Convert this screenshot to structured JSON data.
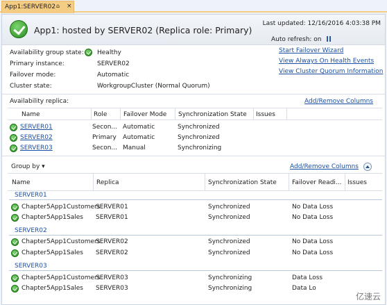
{
  "tab": {
    "title": "App1:SERVER02",
    "pin": "⌂",
    "close": "×"
  },
  "header": {
    "title": "App1: hosted by SERVER02 (Replica role: Primary)",
    "last_updated": "Last updated: 12/16/2016 4:03:38 PM",
    "auto_refresh": "Auto refresh: on"
  },
  "summary": {
    "ag_state_label": "Availability group state:",
    "ag_state_value": "Healthy",
    "primary_label": "Primary instance:",
    "primary_value": "SERVER02",
    "failover_label": "Failover mode:",
    "failover_value": "Automatic",
    "cluster_label": "Cluster state:",
    "cluster_value": "WorkgroupCluster (Normal Quorum)"
  },
  "links": {
    "start_failover": "Start Failover Wizard",
    "health_events": "View Always On Health Events",
    "quorum": "View Cluster Quorum Information"
  },
  "replicas": {
    "label": "Availability replica:",
    "add_remove": "Add/Remove Columns",
    "columns": [
      "Name",
      "Role",
      "Failover Mode",
      "Synchronization State",
      "Issues"
    ],
    "rows": [
      {
        "name": "SERVER01",
        "role": "Secon...",
        "failover": "Automatic",
        "sync": "Synchronized",
        "issues": ""
      },
      {
        "name": "SERVER02",
        "role": "Primary",
        "failover": "Automatic",
        "sync": "Synchronized",
        "issues": ""
      },
      {
        "name": "SERVER03",
        "role": "Secon...",
        "failover": "Manual",
        "sync": "Synchronizing",
        "issues": ""
      }
    ]
  },
  "databases": {
    "group_by": "Group by ▾",
    "add_remove": "Add/Remove Columns",
    "columns": [
      "Name",
      "Replica",
      "Synchronization State",
      "Failover Readi...",
      "Issues"
    ],
    "groups": [
      {
        "title": "SERVER01",
        "rows": [
          {
            "name": "Chapter5App1Customers",
            "replica": "SERVER01",
            "sync": "Synchronized",
            "ready": "No Data Loss"
          },
          {
            "name": "Chapter5App1Sales",
            "replica": "SERVER01",
            "sync": "Synchronized",
            "ready": "No Data Loss"
          }
        ]
      },
      {
        "title": "SERVER02",
        "rows": [
          {
            "name": "Chapter5App1Customers",
            "replica": "SERVER02",
            "sync": "Synchronized",
            "ready": "No Data Loss"
          },
          {
            "name": "Chapter5App1Sales",
            "replica": "SERVER02",
            "sync": "Synchronized",
            "ready": "No Data Loss"
          }
        ]
      },
      {
        "title": "SERVER03",
        "rows": [
          {
            "name": "Chapter5App1Customers",
            "replica": "SERVER03",
            "sync": "Synchronizing",
            "ready": "Data Loss"
          },
          {
            "name": "Chapter5App1Sales",
            "replica": "SERVER03",
            "sync": "Synchronizing",
            "ready": "Data Lo"
          }
        ]
      }
    ]
  },
  "watermark": "亿速云"
}
